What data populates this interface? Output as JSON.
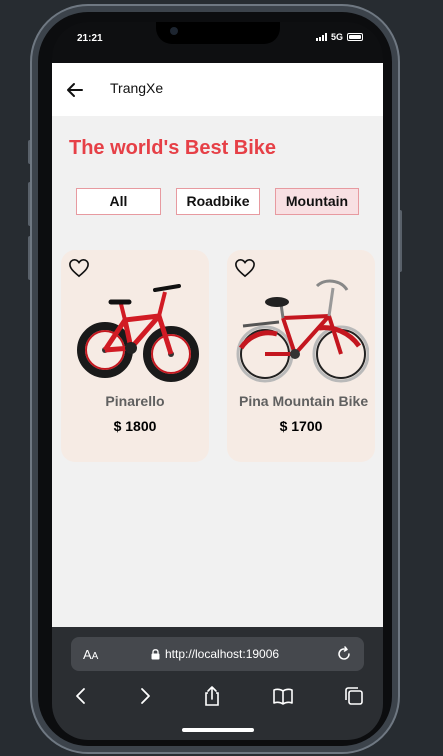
{
  "status": {
    "time": "21:21",
    "network": "5G"
  },
  "appbar": {
    "title": "TrangXe",
    "back_icon": "arrow-left-icon"
  },
  "hero": {
    "headline": "The world's Best Bike"
  },
  "filters": [
    {
      "label": "All",
      "active": false
    },
    {
      "label": "Roadbike",
      "active": false
    },
    {
      "label": "Mountain",
      "active": true
    }
  ],
  "products": [
    {
      "name": "Pinarello",
      "price": "$ 1800",
      "favorite_icon": "heart-outline-icon",
      "image": "red-bmx-bike"
    },
    {
      "name": "Pina Mountain Bike",
      "price": "$ 1700",
      "favorite_icon": "heart-outline-icon",
      "image": "red-cruiser-bike"
    }
  ],
  "browser": {
    "text_size_label_big": "A",
    "text_size_label_small": "A",
    "url": "http://localhost:19006",
    "icons": [
      "lock-icon",
      "reload-icon",
      "back-icon",
      "forward-icon",
      "share-icon",
      "bookmarks-icon",
      "tabs-icon"
    ]
  },
  "colors": {
    "accent": "#e64047",
    "card_bg": "#f6ebe4",
    "active_filter_bg": "#f8e0e3",
    "filter_border": "#e79aa0",
    "browser_bg": "#2b2e32"
  }
}
